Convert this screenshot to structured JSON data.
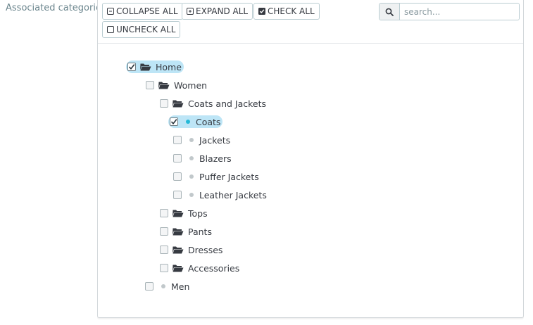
{
  "field": {
    "label": "Associated categories"
  },
  "toolbar": {
    "collapse_all": "COLLAPSE ALL",
    "expand_all": "EXPAND ALL",
    "check_all": "CHECK ALL",
    "uncheck_all": "UNCHECK ALL"
  },
  "search": {
    "placeholder": "search..."
  },
  "tree": {
    "home": {
      "label": "Home",
      "checked": true
    },
    "women": {
      "label": "Women",
      "checked": false
    },
    "coats_jackets": {
      "label": "Coats and Jackets",
      "checked": false
    },
    "coats": {
      "label": "Coats",
      "checked": true
    },
    "jackets": {
      "label": "Jackets",
      "checked": false
    },
    "blazers": {
      "label": "Blazers",
      "checked": false
    },
    "puffer": {
      "label": "Puffer Jackets",
      "checked": false
    },
    "leather": {
      "label": "Leather Jackets",
      "checked": false
    },
    "tops": {
      "label": "Tops",
      "checked": false
    },
    "pants": {
      "label": "Pants",
      "checked": false
    },
    "dresses": {
      "label": "Dresses",
      "checked": false
    },
    "accessories": {
      "label": "Accessories",
      "checked": false
    },
    "men": {
      "label": "Men",
      "checked": false
    }
  },
  "colors": {
    "accent": "#25b9d7",
    "selected_bg": "#bde5f6",
    "text": "#363a41"
  }
}
